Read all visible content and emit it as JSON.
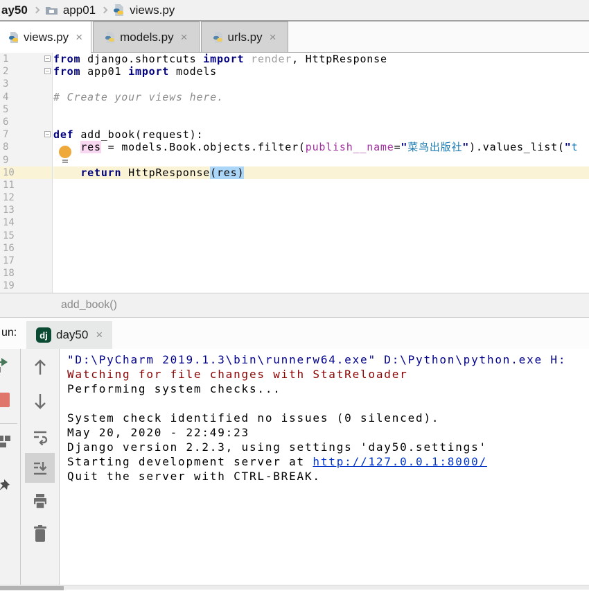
{
  "breadcrumb": {
    "project": "ay50",
    "package": "app01",
    "file": "views.py"
  },
  "tabs": [
    {
      "label": "views.py",
      "active": true
    },
    {
      "label": "models.py",
      "active": false
    },
    {
      "label": "urls.py",
      "active": false
    }
  ],
  "icons": {
    "close": "×"
  },
  "editor": {
    "lines": [
      {
        "n": 1,
        "fold": true,
        "seg": [
          [
            "kw",
            "from"
          ],
          [
            "pl",
            " django.shortcuts "
          ],
          [
            "kw",
            "import"
          ],
          [
            "pl",
            " "
          ],
          [
            "dim",
            "render"
          ],
          [
            "pl",
            ", HttpResponse"
          ]
        ]
      },
      {
        "n": 2,
        "fold": true,
        "seg": [
          [
            "kw",
            "from"
          ],
          [
            "pl",
            " app01 "
          ],
          [
            "kw",
            "import"
          ],
          [
            "pl",
            " models"
          ]
        ]
      },
      {
        "n": 3,
        "seg": []
      },
      {
        "n": 4,
        "seg": [
          [
            "cm",
            "# Create your views here."
          ]
        ]
      },
      {
        "n": 5,
        "seg": []
      },
      {
        "n": 6,
        "seg": []
      },
      {
        "n": 7,
        "fold": true,
        "seg": [
          [
            "kw",
            "def"
          ],
          [
            "pl",
            " add_book(request):"
          ]
        ]
      },
      {
        "n": 8,
        "seg": [
          [
            "pl",
            "    "
          ],
          [
            "pink",
            "res"
          ],
          [
            "pl",
            " = models.Book.objects.filter("
          ],
          [
            "param",
            "publish__name"
          ],
          [
            "pl",
            "="
          ],
          [
            "strq",
            "\""
          ],
          [
            "str",
            "菜鸟出版社"
          ],
          [
            "strq",
            "\""
          ],
          [
            "pl",
            ").values_list("
          ],
          [
            "strq",
            "\""
          ],
          [
            "str",
            "t"
          ]
        ]
      },
      {
        "n": 9,
        "seg": []
      },
      {
        "n": 10,
        "current": true,
        "seg": [
          [
            "pl",
            "    "
          ],
          [
            "kw",
            "return"
          ],
          [
            "pl",
            " HttpResponse"
          ],
          [
            "blue",
            "(res)"
          ]
        ]
      },
      {
        "n": 11,
        "seg": []
      },
      {
        "n": 12,
        "seg": []
      },
      {
        "n": 13,
        "seg": []
      },
      {
        "n": 14,
        "seg": []
      },
      {
        "n": 15,
        "seg": []
      },
      {
        "n": 16,
        "seg": []
      },
      {
        "n": 17,
        "seg": []
      },
      {
        "n": 18,
        "seg": []
      },
      {
        "n": 19,
        "seg": []
      }
    ]
  },
  "editor_breadcrumb": {
    "context": "add_book()"
  },
  "run": {
    "label": "un:",
    "tab_name": "day50",
    "icon_text": "dj"
  },
  "console": {
    "lines": [
      [
        [
          "cmd",
          "\"D:\\PyCharm 2019.1.3\\bin\\runnerw64.exe\" D:\\Python\\python.exe H:"
        ]
      ],
      [
        [
          "err",
          "Watching for file changes with StatReloader"
        ]
      ],
      [
        [
          "pl",
          "Performing system checks..."
        ]
      ],
      [],
      [
        [
          "pl",
          "System check identified no issues (0 silenced)."
        ]
      ],
      [
        [
          "pl",
          "May 20, 2020 - 22:49:23"
        ]
      ],
      [
        [
          "pl",
          "Django version 2.2.3, using settings 'day50.settings'"
        ]
      ],
      [
        [
          "pl",
          "Starting development server at "
        ],
        [
          "link",
          "http://127.0.0.1:8000/"
        ]
      ],
      [
        [
          "pl",
          "Quit the server with CTRL-BREAK."
        ]
      ]
    ]
  },
  "colors": {
    "keyword": "#000080",
    "string": "#1879b0",
    "parameter": "#a0309d",
    "comment": "#8c8c8c",
    "current_line": "#fbf3d5",
    "console_command": "#00008b",
    "console_error": "#8b0000",
    "link": "#0033cc",
    "django_icon_bg": "#0c4b33",
    "stop_red": "#e0756b",
    "rerun_green": "#47785a"
  }
}
